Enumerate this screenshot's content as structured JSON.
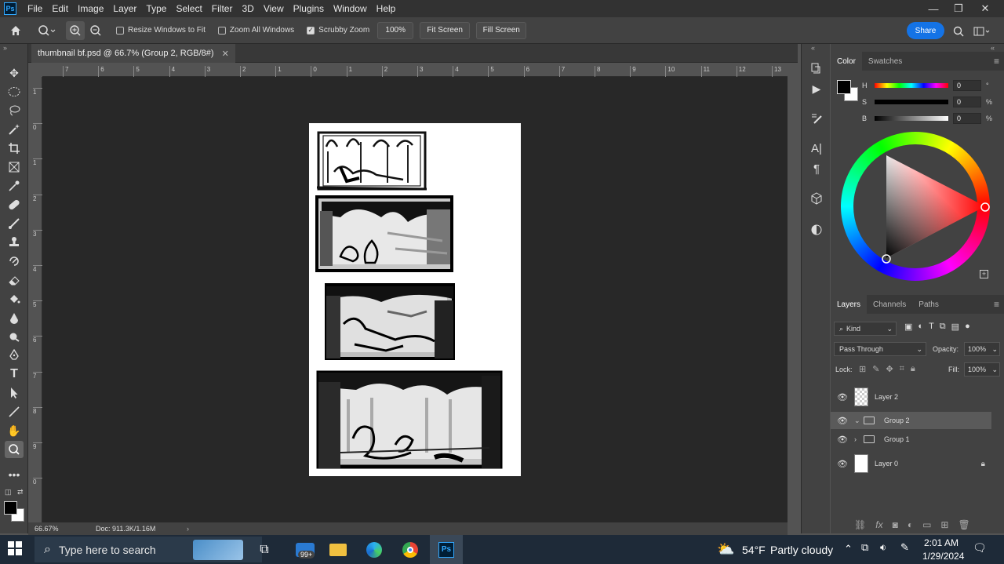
{
  "menubar": {
    "logo": "Ps",
    "items": [
      "File",
      "Edit",
      "Image",
      "Layer",
      "Type",
      "Select",
      "Filter",
      "3D",
      "View",
      "Plugins",
      "Window",
      "Help"
    ]
  },
  "options": {
    "resize_windows": "Resize Windows to Fit",
    "zoom_all": "Zoom All Windows",
    "scrubby_zoom": "Scrubby Zoom",
    "zoom_pct": "100%",
    "fit_screen": "Fit Screen",
    "fill_screen": "Fill Screen",
    "share": "Share"
  },
  "document": {
    "tab_title": "thumbnail bf.psd @ 66.7% (Group 2, RGB/8#)"
  },
  "ruler_h": [
    "7",
    "6",
    "5",
    "4",
    "3",
    "2",
    "1",
    "0",
    "1",
    "2",
    "3",
    "4",
    "5",
    "6",
    "7",
    "8",
    "9",
    "10",
    "11",
    "12",
    "13"
  ],
  "ruler_v": [
    "1",
    "0",
    "1",
    "2",
    "3",
    "4",
    "5",
    "6",
    "7",
    "8",
    "9",
    "0"
  ],
  "status": {
    "zoom": "66.67%",
    "doc": "Doc: 911.3K/1.16M"
  },
  "color_panel": {
    "tabs": [
      "Color",
      "Swatches"
    ],
    "h_label": "H",
    "h_value": "0",
    "s_label": "S",
    "s_value": "0",
    "b_label": "B",
    "b_value": "0",
    "h_unit": "°",
    "pct": "%"
  },
  "layers_panel": {
    "tabs": [
      "Layers",
      "Channels",
      "Paths"
    ],
    "kind": "Kind",
    "blend_mode": "Pass Through",
    "opacity_label": "Opacity:",
    "opacity": "100%",
    "lock_label": "Lock:",
    "fill_label": "Fill:",
    "fill": "100%",
    "layers": [
      "Layer 2",
      "Group 2",
      "Group 1",
      "Layer 0"
    ]
  },
  "taskbar": {
    "search": "Type here to search",
    "badge": "99+",
    "temp": "54°F",
    "weather": "Partly cloudy",
    "time": "2:01 AM",
    "date": "1/29/2024"
  },
  "colors": {
    "accent": "#1473e6",
    "app_bg": "#535353",
    "canvas_bg": "#282828"
  }
}
